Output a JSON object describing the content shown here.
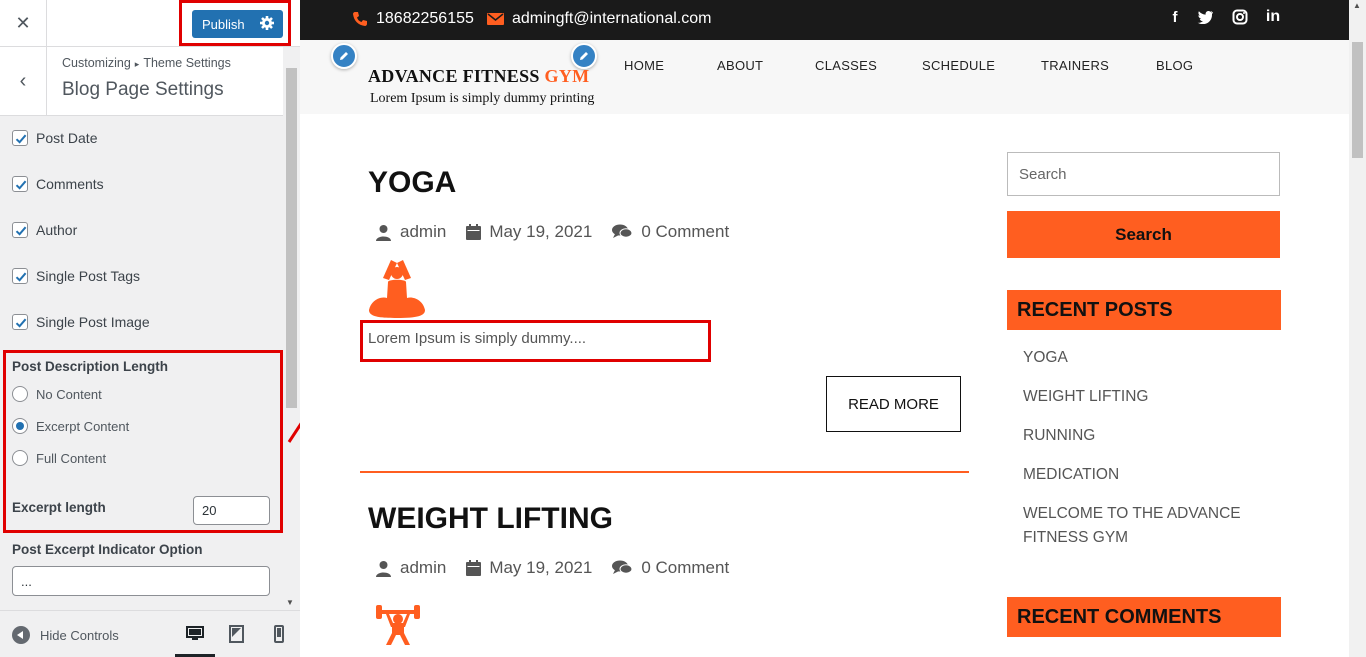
{
  "customizer": {
    "publish_label": "Publish",
    "breadcrumb": [
      "Customizing",
      "Theme Settings"
    ],
    "breadcrumb_sep": "▸",
    "section_title": "Blog Page Settings",
    "checkboxes": [
      {
        "label": "Post Date",
        "checked": true
      },
      {
        "label": "Comments",
        "checked": true
      },
      {
        "label": "Author",
        "checked": true
      },
      {
        "label": "Single Post Tags",
        "checked": true
      },
      {
        "label": "Single Post Image",
        "checked": true
      }
    ],
    "desc_length_label": "Post Description Length",
    "radios": [
      {
        "label": "No Content",
        "selected": false
      },
      {
        "label": "Excerpt Content",
        "selected": true
      },
      {
        "label": "Full Content",
        "selected": false
      }
    ],
    "excerpt_length_label": "Excerpt length",
    "excerpt_length_value": "20",
    "indicator_label": "Post Excerpt Indicator Option",
    "indicator_value": "...",
    "hide_controls_label": "Hide Controls"
  },
  "site": {
    "phone": "18682256155",
    "email": "admingft@international.com",
    "social_icons": [
      "facebook-icon",
      "twitter-icon",
      "instagram-icon",
      "linkedin-icon"
    ],
    "logo_title": "ADVANCE FITNESS ",
    "logo_title_accent": "GYM",
    "logo_tagline": "Lorem Ipsum is simply dummy printing",
    "nav": [
      "HOME",
      "ABOUT",
      "CLASSES",
      "SCHEDULE",
      "TRAINERS",
      "BLOG"
    ],
    "posts": [
      {
        "title": "YOGA",
        "author": "admin",
        "date": "May 19, 2021",
        "comments": "0 Comment",
        "excerpt": "Lorem Ipsum is simply dummy....",
        "read_more": "READ MORE"
      },
      {
        "title": "WEIGHT LIFTING",
        "author": "admin",
        "date": "May 19, 2021",
        "comments": "0 Comment"
      }
    ],
    "search_placeholder": "Search",
    "search_button": "Search",
    "recent_posts_title": "RECENT POSTS",
    "recent_posts": [
      "YOGA",
      "WEIGHT LIFTING",
      "RUNNING",
      "MEDICATION",
      "WELCOME TO THE ADVANCE FITNESS GYM"
    ],
    "recent_comments_title": "RECENT COMMENTS"
  },
  "colors": {
    "accent": "#ff5e20",
    "wp_blue": "#2271b1",
    "annotation_red": "#e00000",
    "topbar": "#1a1a1a"
  }
}
